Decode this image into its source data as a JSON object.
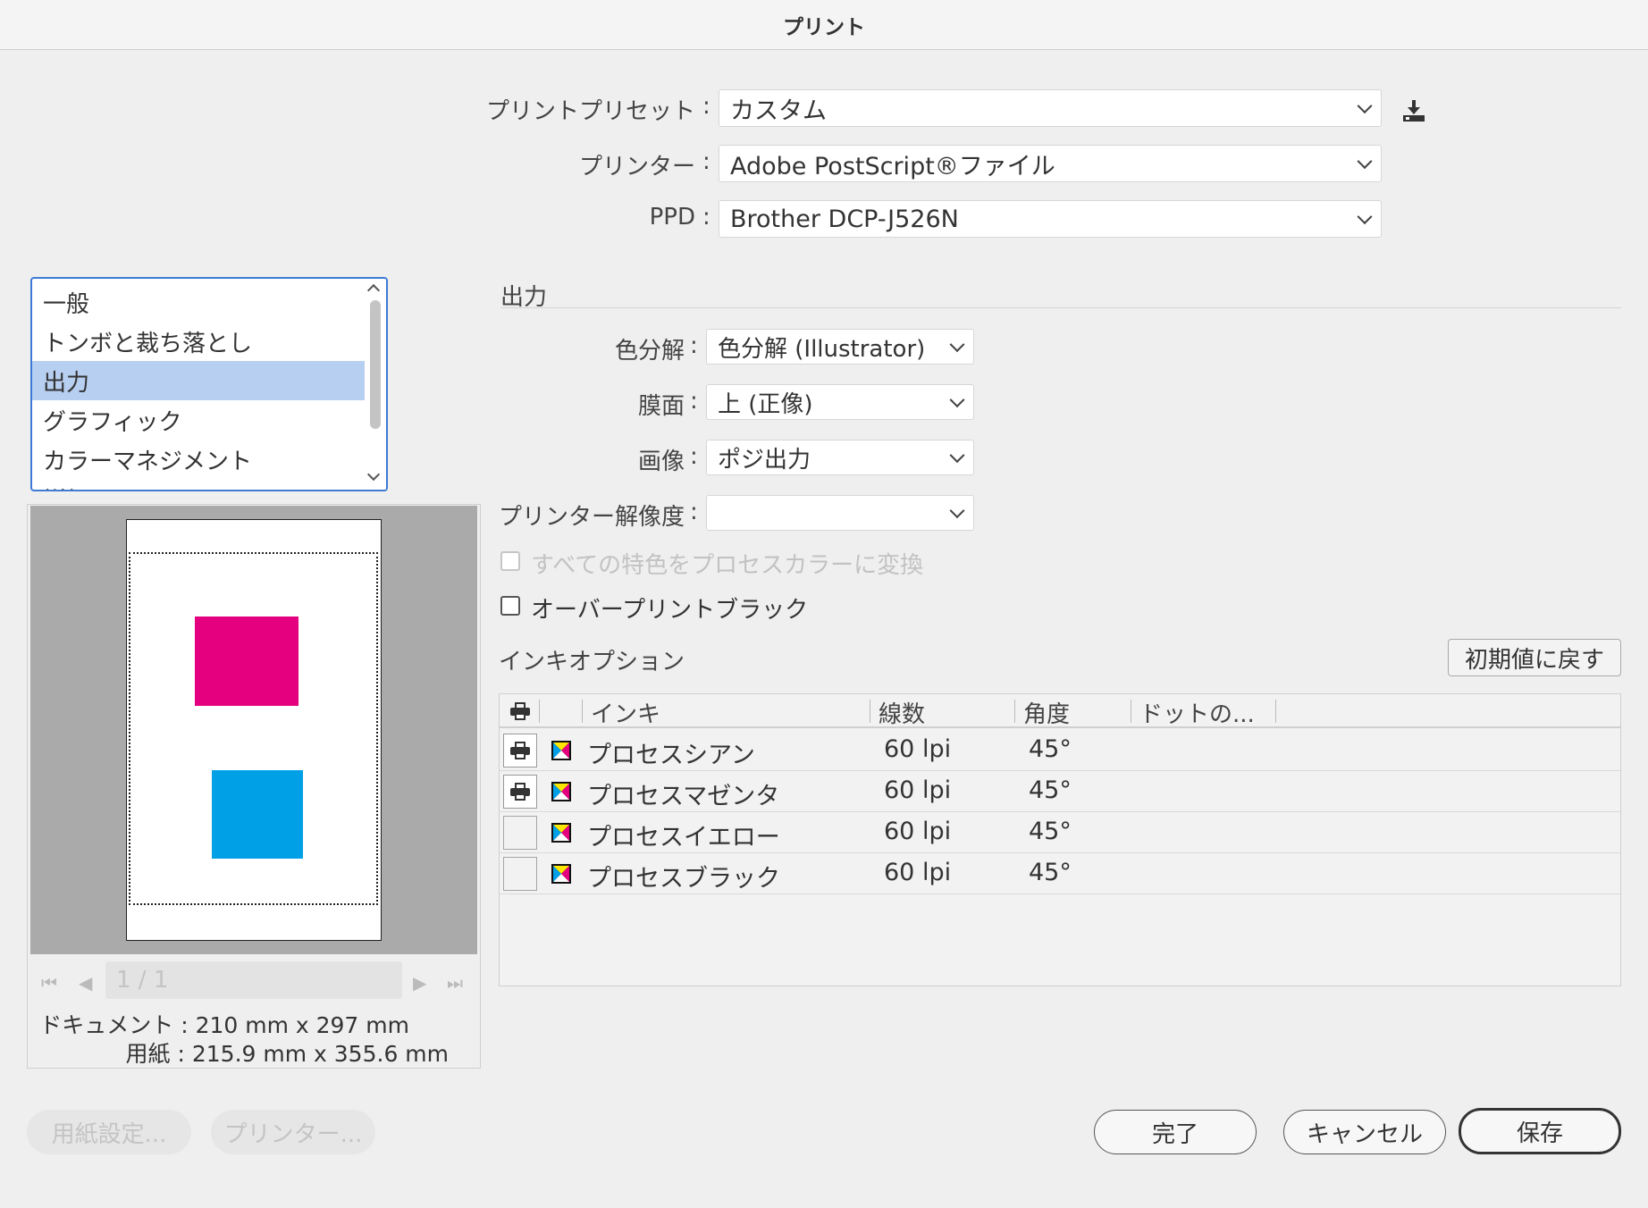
{
  "window": {
    "title": "プリント"
  },
  "preset": {
    "preset_label": "プリントプリセット",
    "preset_value": "カスタム",
    "printer_label": "プリンター",
    "printer_value": "Adobe PostScript®ファイル",
    "ppd_label": "PPD",
    "ppd_value": "Brother DCP-J526N",
    "colon": ":",
    "save_icon": "save-preset-icon"
  },
  "categories": {
    "items": [
      {
        "label": "一般"
      },
      {
        "label": "トンボと裁ち落とし"
      },
      {
        "label": "出力",
        "selected": true
      },
      {
        "label": "グラフィック"
      },
      {
        "label": "カラーマネジメント"
      },
      {
        "label": "詳細"
      }
    ]
  },
  "preview": {
    "page_field": "1 / 1",
    "document_label": "ドキュメント : 210 mm x 297 mm",
    "paper_label": "用紙 : 215.9 mm x 355.6 mm",
    "swatch_colors": [
      "#e4007f",
      "#00a0e6"
    ]
  },
  "output": {
    "section_title": "出力",
    "separation_label": "色分解",
    "separation_value": "色分解 (Illustrator)",
    "emulsion_label": "膜面",
    "emulsion_value": "上 (正像)",
    "image_label": "画像",
    "image_value": "ポジ出力",
    "resolution_label": "プリンター解像度",
    "resolution_value": "",
    "convert_spot_label": "すべての特色をプロセスカラーに変換",
    "overprint_black_label": "オーバープリントブラック"
  },
  "ink_options": {
    "title": "インキオプション",
    "reset_button": "初期値に戻す",
    "columns": {
      "ink": "インキ",
      "frequency": "線数",
      "angle": "角度",
      "dot": "ドットの..."
    },
    "rows": [
      {
        "name": "プロセスシアン",
        "frequency": "60 lpi",
        "angle": "45°",
        "print": true
      },
      {
        "name": "プロセスマゼンタ",
        "frequency": "60 lpi",
        "angle": "45°",
        "print": true
      },
      {
        "name": "プロセスイエロー",
        "frequency": "60 lpi",
        "angle": "45°",
        "print": false
      },
      {
        "name": "プロセスブラック",
        "frequency": "60 lpi",
        "angle": "45°",
        "print": false
      }
    ]
  },
  "buttons": {
    "page_setup": "用紙設定...",
    "printer": "プリンター...",
    "done": "完了",
    "cancel": "キャンセル",
    "save": "保存"
  },
  "colors": {
    "accent": "#3d7bd6",
    "selection": "#b7cff0",
    "magenta": "#e4007f",
    "cyan": "#00a0e6"
  }
}
